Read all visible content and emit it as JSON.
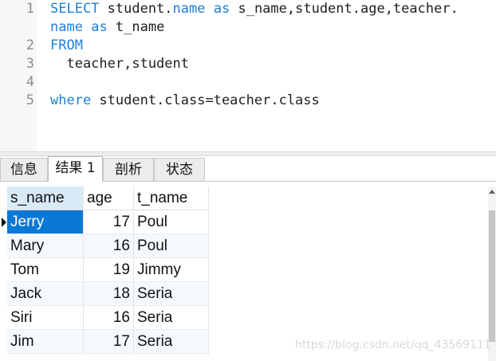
{
  "editor": {
    "line_numbers": [
      "1",
      "2",
      "3",
      "4",
      "5"
    ],
    "lines": [
      [
        {
          "t": "SELECT",
          "k": true
        },
        {
          "t": " student.",
          "k": false
        },
        {
          "t": "name",
          "k": true
        },
        {
          "t": " ",
          "k": false
        },
        {
          "t": "as",
          "k": true
        },
        {
          "t": " s_name,student.age,teacher.",
          "k": false
        }
      ],
      [
        {
          "t": "name",
          "k": true
        },
        {
          "t": " ",
          "k": false
        },
        {
          "t": "as",
          "k": true
        },
        {
          "t": " t_name",
          "k": false
        }
      ],
      [
        {
          "t": "FROM",
          "k": true
        }
      ],
      [
        {
          "t": "  teacher,student",
          "k": false
        }
      ],
      [],
      [
        {
          "t": "where",
          "k": true
        },
        {
          "t": " student.class=teacher.class",
          "k": false
        }
      ]
    ]
  },
  "tabs": [
    {
      "label": "信息",
      "active": false
    },
    {
      "label": "结果 1",
      "active": true
    },
    {
      "label": "剖析",
      "active": false
    },
    {
      "label": "状态",
      "active": false
    }
  ],
  "result": {
    "columns": [
      "s_name",
      "age",
      "t_name"
    ],
    "rows": [
      [
        "Jerry",
        "17",
        "Poul"
      ],
      [
        "Mary",
        "16",
        "Poul"
      ],
      [
        "Tom",
        "19",
        "Jimmy"
      ],
      [
        "Jack",
        "18",
        "Seria"
      ],
      [
        "Siri",
        "16",
        "Seria"
      ],
      [
        "Jim",
        "17",
        "Seria"
      ]
    ],
    "selected_row": 0
  },
  "watermark": "https://blog.csdn.net/qq_43569111",
  "colors": {
    "keyword": "#1f7fd6",
    "selection": "#0a78d7",
    "header_selected": "#d9eaf7"
  }
}
